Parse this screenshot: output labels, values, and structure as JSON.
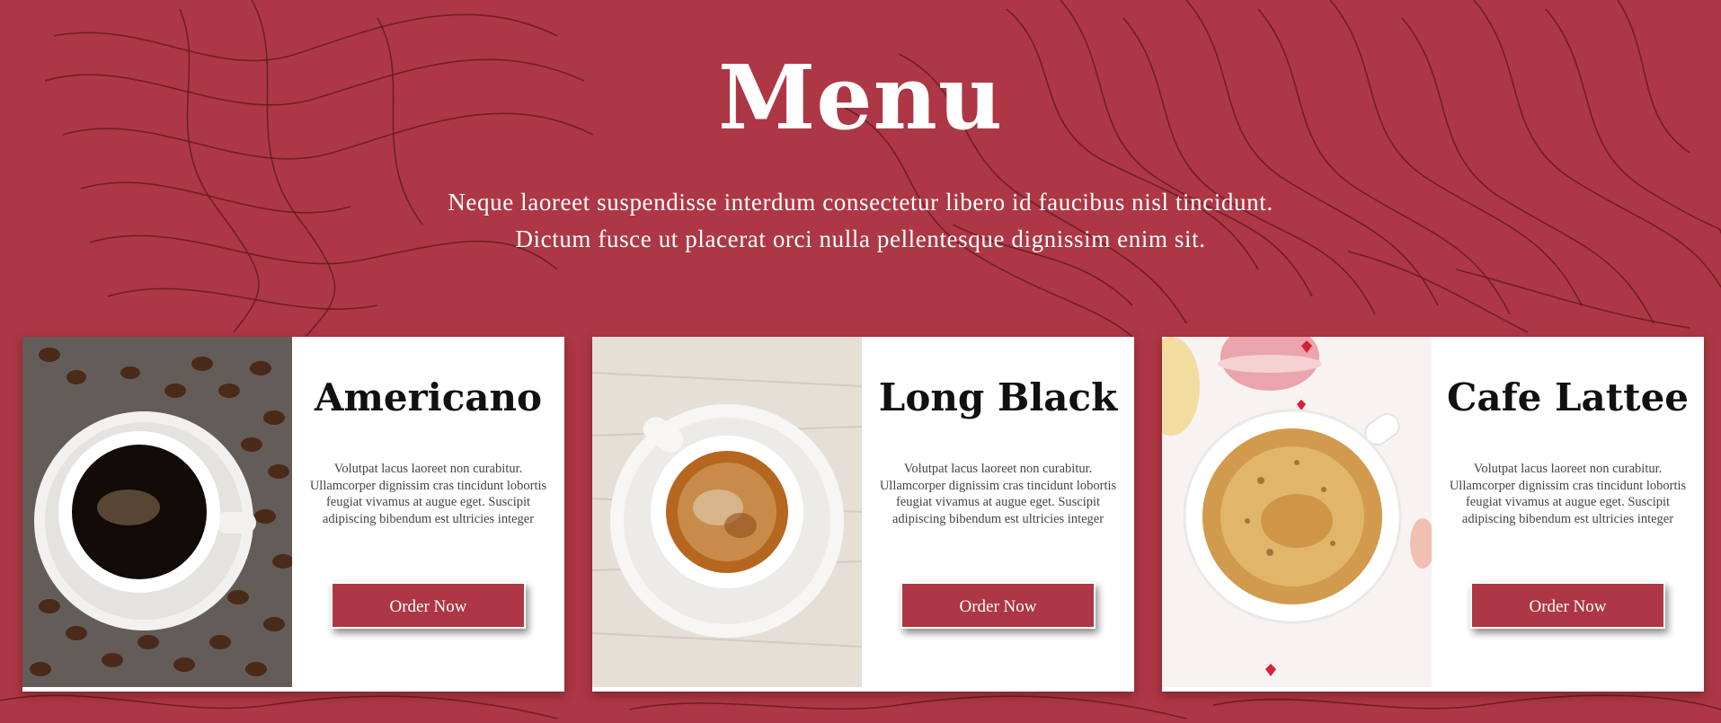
{
  "page": {
    "title": "Menu",
    "subtitle_line1": "Neque laoreet suspendisse interdum consectetur libero id faucibus nisl tincidunt.",
    "subtitle_line2": "Dictum fusce ut placerat orci nulla pellentesque dignissim enim sit."
  },
  "colors": {
    "brand": "#ad3744",
    "line_pattern": "#5e1620",
    "card_bg": "#ffffff"
  },
  "cards": [
    {
      "name": "Americano",
      "description": "Volutpat lacus laoreet non curabitur. Ullamcorper dignissim cras tincidunt lobortis feugiat vivamus at augue eget. Suscipit adipiscing bibendum est ultricies integer",
      "button_label": "Order Now",
      "image": "black-coffee-cup-with-beans"
    },
    {
      "name": "Long Black",
      "description": "Volutpat lacus laoreet non curabitur. Ullamcorper dignissim cras tincidunt lobortis feugiat vivamus at augue eget. Suscipit adipiscing bibendum est ultricies integer",
      "button_label": "Order Now",
      "image": "espresso-cup-on-saucer"
    },
    {
      "name": "Cafe Lattee",
      "description": "Volutpat lacus laoreet non curabitur. Ullamcorper dignissim cras tincidunt lobortis feugiat vivamus at augue eget. Suscipit adipiscing bibendum est ultricies integer",
      "button_label": "Order Now",
      "image": "latte-cup-with-macarons"
    }
  ]
}
